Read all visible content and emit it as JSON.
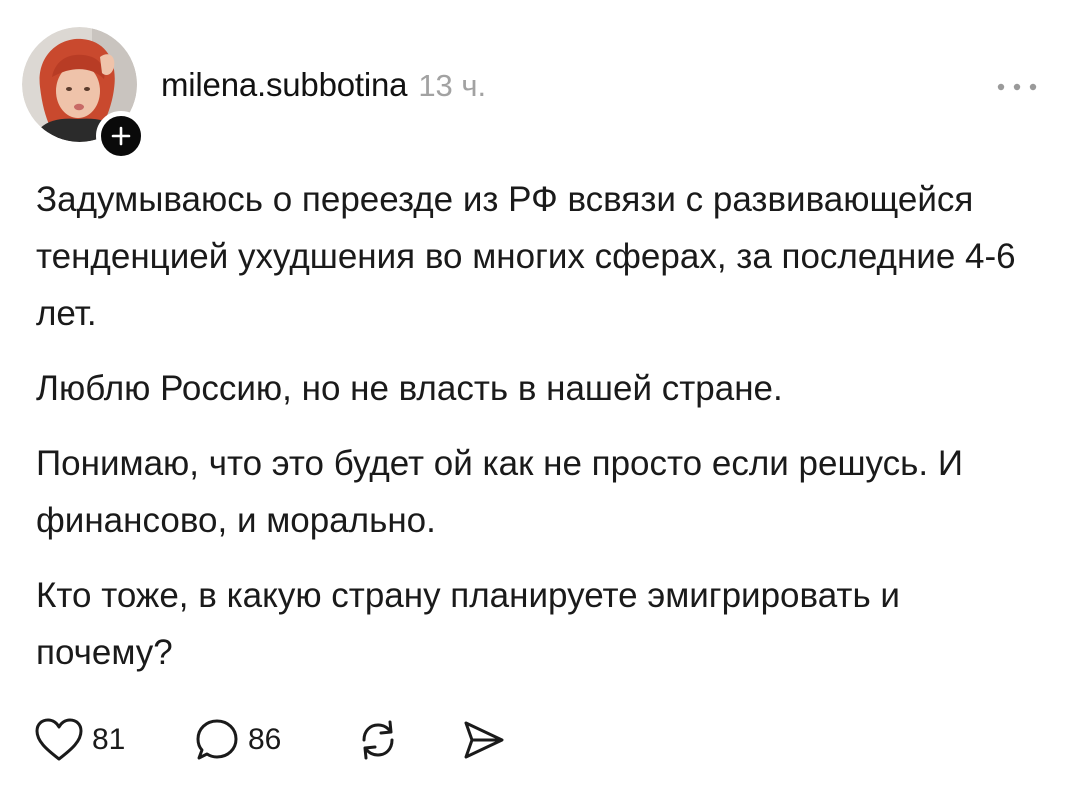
{
  "post": {
    "author": {
      "username": "milena.subbotina",
      "avatar_icon": "avatar-photo"
    },
    "time": "13 ч.",
    "paragraphs": [
      "Задумываюсь о переезде из РФ всвязи с развивающейся тенденцией ухудшения во многих сферах, за последние 4-6 лет.",
      "Люблю Россию, но не власть в нашей стране.",
      "Понимаю, что это будет ой как не просто если решусь. И финансово, и морально.",
      "Кто тоже, в какую страну планируете эмигрировать и почему?"
    ],
    "actions": {
      "likes": "81",
      "replies": "86",
      "like_icon": "heart-icon",
      "reply_icon": "comment-icon",
      "repost_icon": "repost-icon",
      "share_icon": "share-icon"
    }
  },
  "colors": {
    "text": "#1a1a1a",
    "muted": "#a2a2a2",
    "follow_badge": "#0a0a0a",
    "background": "#ffffff"
  }
}
